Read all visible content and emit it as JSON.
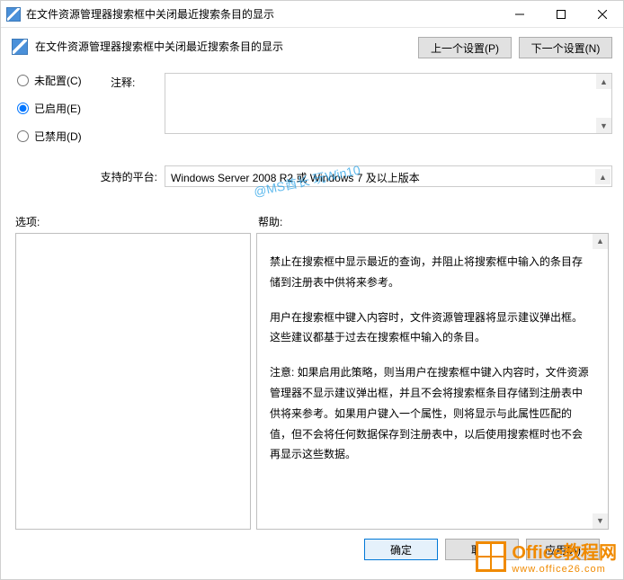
{
  "titlebar": {
    "title": "在文件资源管理器搜索框中关闭最近搜索条目的显示"
  },
  "header": {
    "title": "在文件资源管理器搜索框中关闭最近搜索条目的显示",
    "prev_button": "上一个设置(P)",
    "next_button": "下一个设置(N)"
  },
  "radios": {
    "not_configured": "未配置(C)",
    "enabled": "已启用(E)",
    "disabled": "已禁用(D)",
    "selected": "enabled"
  },
  "comment": {
    "label": "注释:",
    "value": ""
  },
  "platform": {
    "label": "支持的平台:",
    "value": "Windows Server 2008 R2 或 Windows 7 及以上版本"
  },
  "sections": {
    "options_label": "选项:",
    "help_label": "帮助:"
  },
  "help": {
    "p1": "禁止在搜索框中显示最近的查询，并阻止将搜索框中输入的条目存储到注册表中供将来参考。",
    "p2": "用户在搜索框中键入内容时，文件资源管理器将显示建议弹出框。这些建议都基于过去在搜索框中输入的条目。",
    "p3": "注意: 如果启用此策略，则当用户在搜索框中键入内容时，文件资源管理器不显示建议弹出框，并且不会将搜索框条目存储到注册表中供将来参考。如果用户键入一个属性，则将显示与此属性匹配的值，但不会将任何数据保存到注册表中，以后使用搜索框时也不会再显示这些数据。"
  },
  "footer": {
    "ok": "确定",
    "cancel": "取消",
    "apply": "应用(A)"
  },
  "watermark": {
    "text": "@MS酋长 玩Win10"
  },
  "brand": {
    "name": "Office教程网",
    "url": "www.office26.com"
  }
}
